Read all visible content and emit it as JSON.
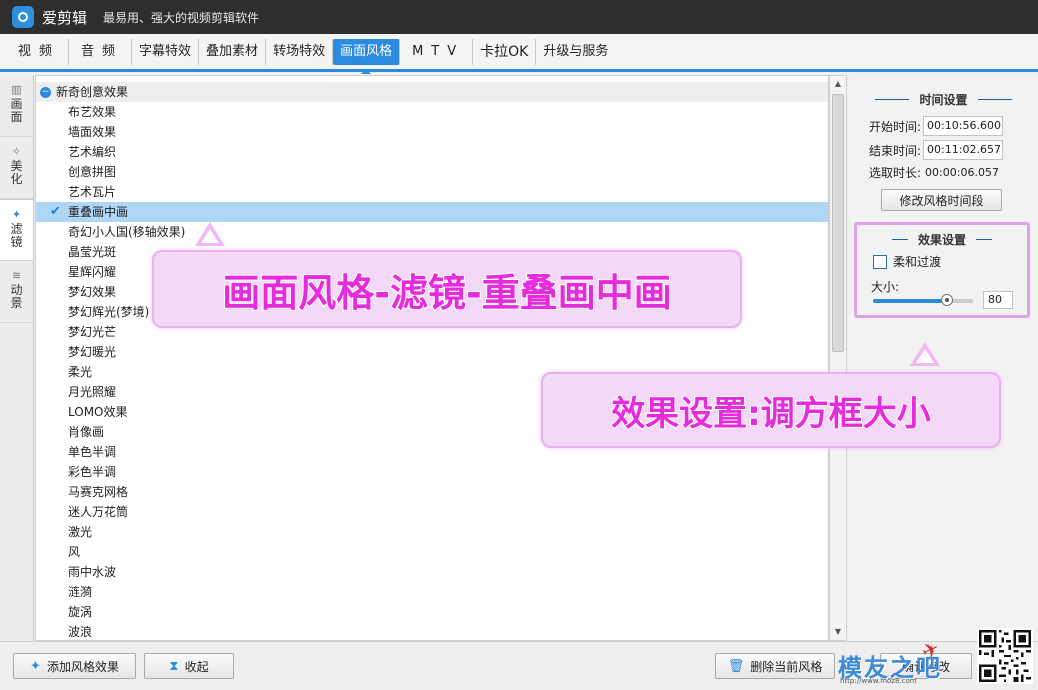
{
  "app": {
    "name": "爱剪辑",
    "slogan": "最易用、强大的视频剪辑软件"
  },
  "tabs": [
    "视频",
    "音频",
    "字幕特效",
    "叠加素材",
    "转场特效",
    "画面风格",
    "MTV",
    "卡拉OK",
    "升级与服务"
  ],
  "active_tab": "画面风格",
  "side_tabs": [
    {
      "label": "画面",
      "icon": "film-icon"
    },
    {
      "label": "美化",
      "icon": "magic-icon"
    },
    {
      "label": "滤镜",
      "icon": "wand-icon"
    },
    {
      "label": "动景",
      "icon": "wave-icon"
    }
  ],
  "active_side_tab": "滤镜",
  "list": {
    "group_label": "新奇创意效果",
    "items": [
      "布艺效果",
      "墙面效果",
      "艺术编织",
      "创意拼图",
      "艺术瓦片",
      "重叠画中画",
      "奇幻小人国(移轴效果)",
      "晶莹光斑",
      "星辉闪耀",
      "梦幻效果",
      "梦幻辉光(梦境)",
      "梦幻光芒",
      "梦幻暖光",
      "柔光",
      "月光照耀",
      "LOMO效果",
      "肖像画",
      "单色半调",
      "彩色半调",
      "马赛克网格",
      "迷人万花筒",
      "激光",
      "风",
      "雨中水波",
      "涟漪",
      "旋涡",
      "波浪"
    ],
    "selected": "重叠画中画"
  },
  "time_settings": {
    "title": "时间设置",
    "start_label": "开始时间:",
    "start_value": "00:10:56.600",
    "end_label": "结束时间:",
    "end_value": "00:11:02.657",
    "duration_label": "选取时长:",
    "duration_value": "00:00:06.057",
    "modify_button": "修改风格时间段"
  },
  "effect_settings": {
    "title": "效果设置",
    "soft_transition_label": "柔和过渡",
    "soft_transition_checked": false,
    "size_label": "大小:",
    "size_value": "80",
    "size_fraction": 0.74
  },
  "bottom": {
    "add_button": "添加风格效果",
    "collapse_button": "收起",
    "delete_button": "删除当前风格",
    "confirm_button": "确认修改"
  },
  "watermark": {
    "text": "模友之吧",
    "url": "http://www.moz8.com"
  },
  "annotations": {
    "main": "画面风格-滤镜-重叠画中画",
    "effect": "效果设置:调方框大小"
  },
  "colors": {
    "accent": "#2b8be0",
    "selection": "#aed6f5",
    "annotation_text": "#e62bdc",
    "annotation_bg": "#f4d8f7"
  }
}
